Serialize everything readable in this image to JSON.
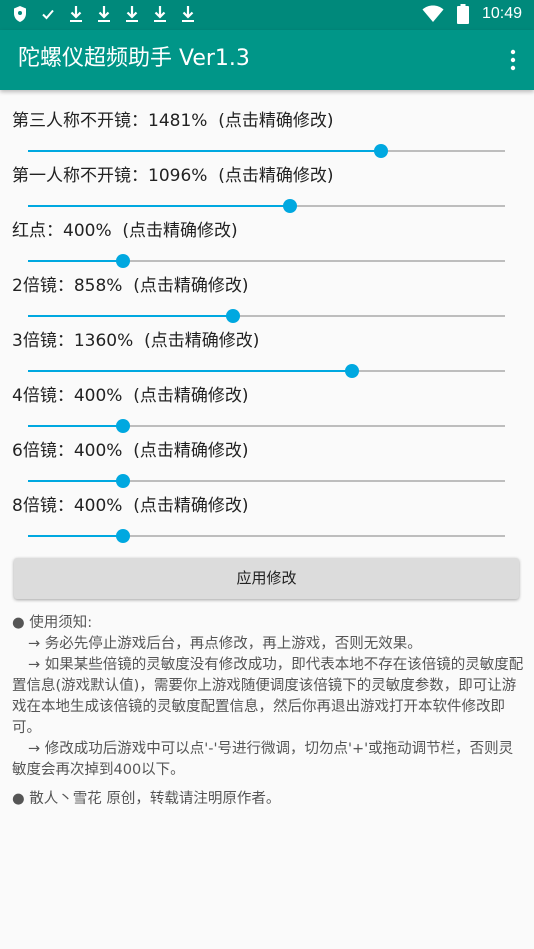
{
  "status_bar": {
    "icons": [
      "shield-icon",
      "check-icon",
      "download-icon",
      "download-icon",
      "download-icon",
      "download-icon",
      "download-icon"
    ],
    "time": "10:49"
  },
  "app_bar": {
    "title": "陀螺仪超频助手 Ver1.3"
  },
  "colors": {
    "status_bar": "#00897b",
    "app_bar": "#009688",
    "slider_accent": "#00a8e0"
  },
  "settings": [
    {
      "name": "第三人称不开镜",
      "value": "1481%",
      "hint": "(点击精确修改)",
      "level": 0.74
    },
    {
      "name": "第一人称不开镜",
      "value": "1096%",
      "hint": "(点击精确修改)",
      "level": 0.55
    },
    {
      "name": "红点",
      "value": "400%",
      "hint": "(点击精确修改)",
      "level": 0.2
    },
    {
      "name": "2倍镜",
      "value": "858%",
      "hint": "(点击精确修改)",
      "level": 0.43
    },
    {
      "name": "3倍镜",
      "value": "1360%",
      "hint": "(点击精确修改)",
      "level": 0.68
    },
    {
      "name": "4倍镜",
      "value": "400%",
      "hint": "(点击精确修改)",
      "level": 0.2
    },
    {
      "name": "6倍镜",
      "value": "400%",
      "hint": "(点击精确修改)",
      "level": 0.2
    },
    {
      "name": "8倍镜",
      "value": "400%",
      "hint": "(点击精确修改)",
      "level": 0.2
    }
  ],
  "apply_button": {
    "label": "应用修改"
  },
  "notes": {
    "heading": "● 使用须知:",
    "lines": [
      "→ 务必先停止游戏后台，再点修改，再上游戏，否则无效果。",
      "→ 如果某些倍镜的灵敏度没有修改成功，即代表本地不存在该倍镜的灵敏度配置信息(游戏默认值)，需要你上游戏随便调度该倍镜下的灵敏度参数，即可让游戏在本地生成该倍镜的灵敏度配置信息，然后你再退出游戏打开本软件修改即可。",
      "→ 修改成功后游戏中可以点'-'号进行微调，切勿点'+'或拖动调节栏，否则灵敏度会再次掉到400以下。"
    ],
    "footer": "● 散人丶雪花 原创，转载请注明原作者。"
  }
}
